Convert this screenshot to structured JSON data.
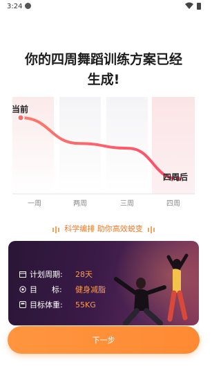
{
  "status_bar": {
    "time": "3:24"
  },
  "heading": {
    "line1": "你的四周舞蹈训练方案已经",
    "line2": "生成!"
  },
  "chart": {
    "start_label": "当前",
    "end_label": "四周后",
    "x_labels": [
      "一周",
      "两周",
      "三周",
      "四周"
    ]
  },
  "chart_data": {
    "type": "line",
    "categories": [
      "一周",
      "两周",
      "三周",
      "四周"
    ],
    "series": [
      {
        "values": [
          1.0,
          0.62,
          0.55,
          0.1
        ]
      }
    ],
    "annotations": [
      "当前",
      "四周后"
    ],
    "colors": {
      "start": "#ff7a6a",
      "end": "#ff4a6a"
    }
  },
  "slogan": "科学编排 助你高效蜕变",
  "plan": {
    "period_label": "计划周期:",
    "period_value": "28天",
    "goal_label": "目      标:",
    "goal_value": "健身减脂",
    "weight_label": "目标体重:",
    "weight_value": "55KG"
  },
  "next_button": "下一步",
  "colors": {
    "accent": "#ff8a33",
    "card_bg": "#2a1636",
    "value_orange": "#ff9b4a"
  }
}
